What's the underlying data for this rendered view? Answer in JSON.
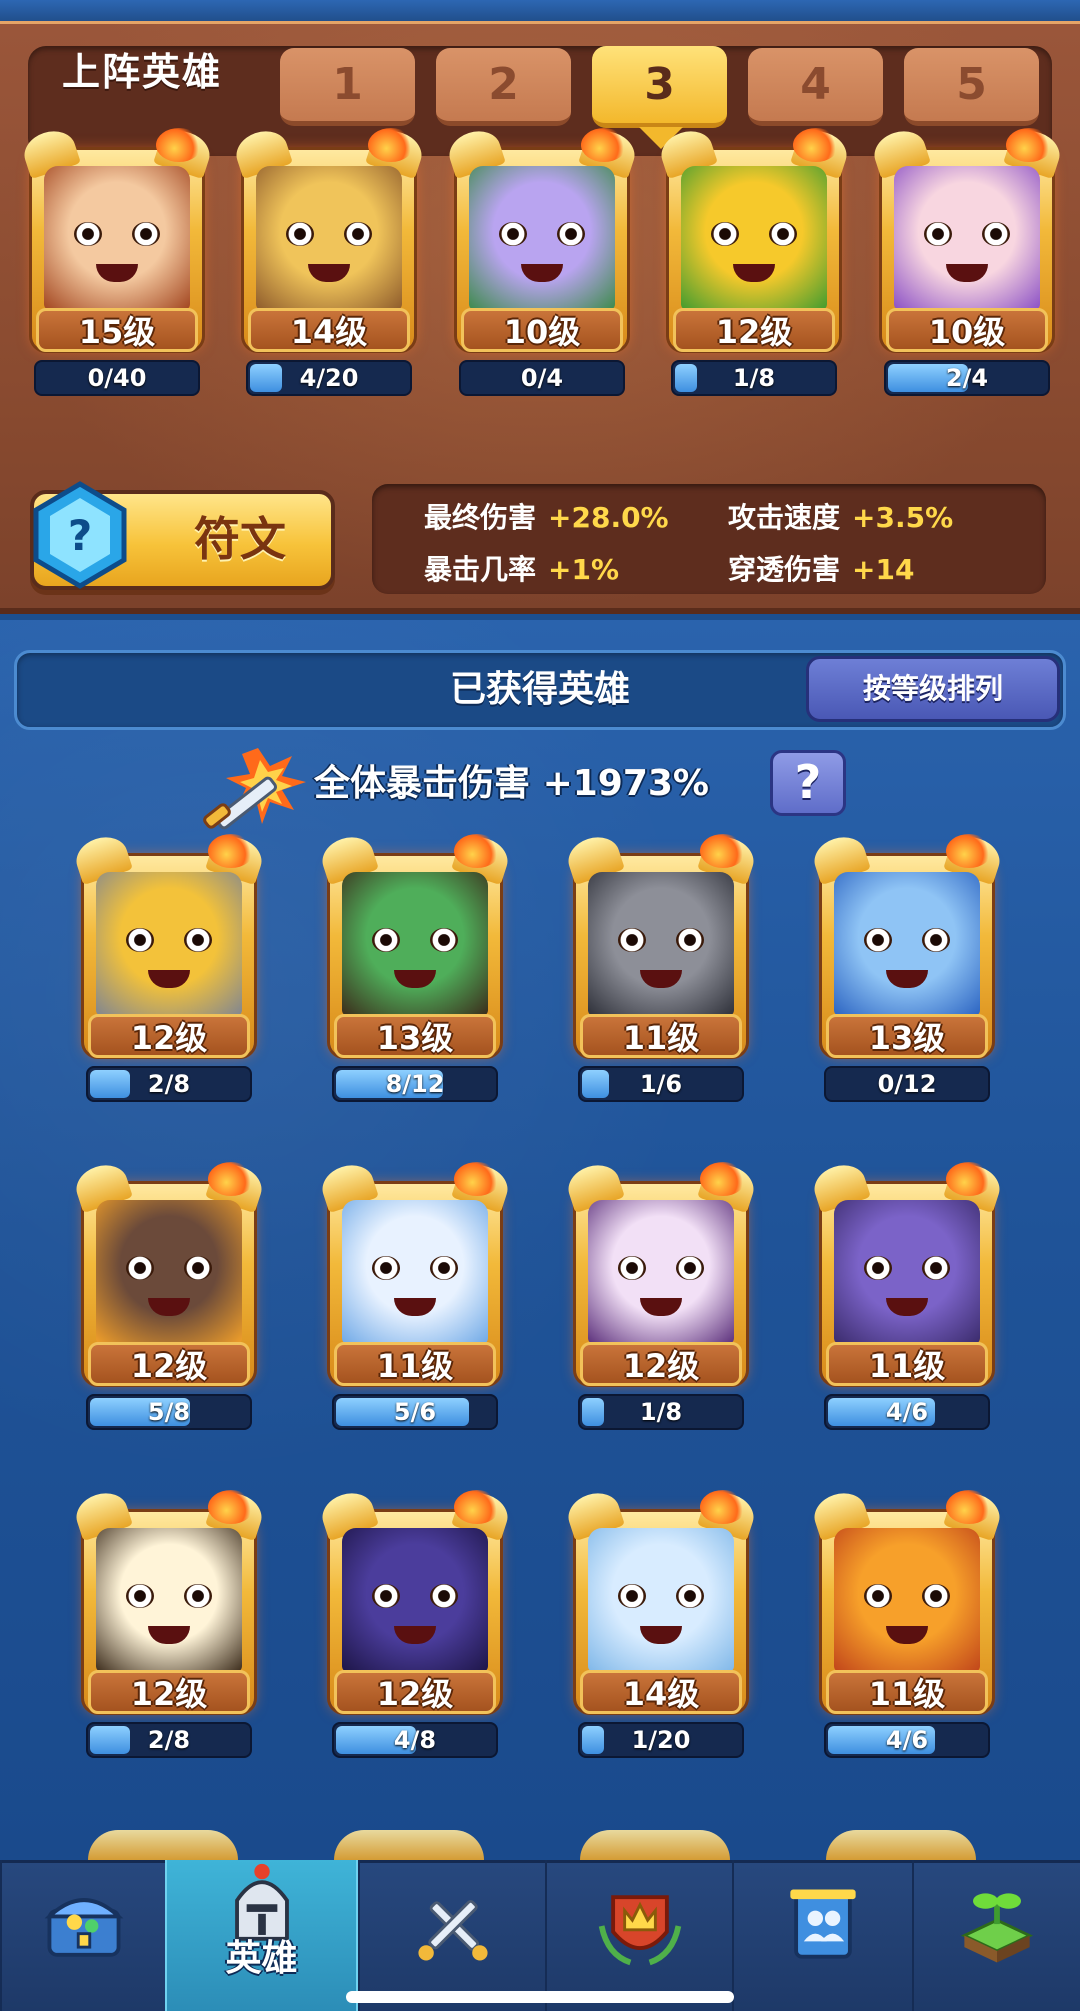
{
  "lineup": {
    "title": "上阵英雄",
    "tabs": [
      "1",
      "2",
      "3",
      "4",
      "5"
    ],
    "active_tab": "3",
    "heroes": [
      {
        "level": "15级",
        "progress": "0/40",
        "fill": 0.0,
        "colors": [
          "#f4c9a0",
          "#a1441e"
        ]
      },
      {
        "level": "14级",
        "progress": "4/20",
        "fill": 0.2,
        "colors": [
          "#f0c45a",
          "#8d5a2b"
        ]
      },
      {
        "level": "10级",
        "progress": "0/4",
        "fill": 0.0,
        "colors": [
          "#b9a4f0",
          "#3c8a4a"
        ]
      },
      {
        "level": "12级",
        "progress": "1/8",
        "fill": 0.125,
        "colors": [
          "#f6c92b",
          "#3f9b2f"
        ]
      },
      {
        "level": "10级",
        "progress": "2/4",
        "fill": 0.5,
        "colors": [
          "#f8d6e0",
          "#8a4fc5"
        ]
      }
    ]
  },
  "rune": {
    "label": "符文"
  },
  "stats": [
    {
      "key": "最终伤害",
      "value": "+28.0%"
    },
    {
      "key": "攻击速度",
      "value": "+3.5%"
    },
    {
      "key": "暴击几率",
      "value": "+1%"
    },
    {
      "key": "穿透伤害",
      "value": "+14"
    }
  ],
  "owned": {
    "title": "已获得英雄",
    "sort_label": "按等级排列",
    "crit_label": "全体暴击伤害",
    "crit_value": "+1973%",
    "help_label": "?",
    "heroes": [
      {
        "level": "12级",
        "progress": "2/8",
        "fill": 0.25,
        "colors": [
          "#f3c23a",
          "#7f8592"
        ]
      },
      {
        "level": "13级",
        "progress": "8/12",
        "fill": 0.667,
        "colors": [
          "#4fae5a",
          "#3b2a1a"
        ]
      },
      {
        "level": "11级",
        "progress": "1/6",
        "fill": 0.167,
        "colors": [
          "#8d8f98",
          "#2d2f38"
        ]
      },
      {
        "level": "13级",
        "progress": "0/12",
        "fill": 0.0,
        "colors": [
          "#8fc4f5",
          "#2b63c1"
        ]
      },
      {
        "level": "12级",
        "progress": "5/8",
        "fill": 0.625,
        "colors": [
          "#6b4a3a",
          "#f2a02a"
        ]
      },
      {
        "level": "11级",
        "progress": "5/6",
        "fill": 0.833,
        "colors": [
          "#e8f2ff",
          "#6ea8e6"
        ]
      },
      {
        "level": "12级",
        "progress": "1/8",
        "fill": 0.125,
        "colors": [
          "#f2e0f6",
          "#5a2e7a"
        ]
      },
      {
        "level": "11级",
        "progress": "4/6",
        "fill": 0.667,
        "colors": [
          "#7b63c8",
          "#3a2b6b"
        ]
      },
      {
        "level": "12级",
        "progress": "2/8",
        "fill": 0.25,
        "colors": [
          "#fff4d8",
          "#3a2a1a"
        ]
      },
      {
        "level": "12级",
        "progress": "4/8",
        "fill": 0.5,
        "colors": [
          "#4b3d9c",
          "#1d1547"
        ]
      },
      {
        "level": "14级",
        "progress": "1/20",
        "fill": 0.05,
        "colors": [
          "#d8ecff",
          "#7fb7e8"
        ]
      },
      {
        "level": "11级",
        "progress": "4/6",
        "fill": 0.667,
        "colors": [
          "#f7a02a",
          "#c0441a"
        ]
      }
    ]
  },
  "nav": {
    "items": [
      {
        "name": "treasure-chest-icon",
        "label": ""
      },
      {
        "name": "knight-helmet-icon",
        "label": "英雄"
      },
      {
        "name": "crossed-swords-icon",
        "label": ""
      },
      {
        "name": "crown-shield-icon",
        "label": ""
      },
      {
        "name": "team-banner-icon",
        "label": ""
      },
      {
        "name": "sprout-island-icon",
        "label": ""
      }
    ],
    "active_index": 1
  }
}
